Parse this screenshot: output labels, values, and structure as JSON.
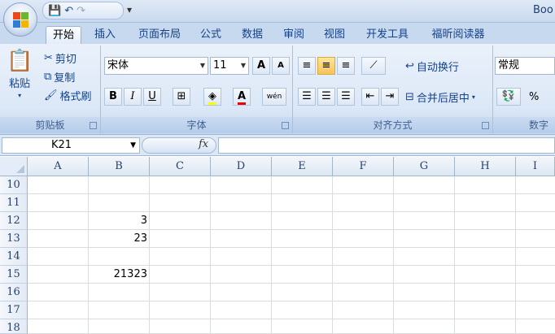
{
  "title": "Boo",
  "quick_access": {
    "save_icon": "save-icon",
    "undo_icon": "undo-icon",
    "redo_icon": "redo-icon",
    "more": "▾"
  },
  "tabs": [
    {
      "label": "开始",
      "active": true
    },
    {
      "label": "插入"
    },
    {
      "label": "页面布局"
    },
    {
      "label": "公式"
    },
    {
      "label": "数据"
    },
    {
      "label": "审阅"
    },
    {
      "label": "视图"
    },
    {
      "label": "开发工具"
    },
    {
      "label": "福昕阅读器"
    }
  ],
  "clipboard": {
    "group_label": "剪贴板",
    "paste": "粘贴",
    "cut": "剪切",
    "copy": "复制",
    "format_painter": "格式刷"
  },
  "font": {
    "group_label": "字体",
    "font_name": "宋体",
    "font_size": "11",
    "bold": "B",
    "italic": "I",
    "underline": "U",
    "grow": "A",
    "shrink": "A",
    "wen": "wén"
  },
  "alignment": {
    "group_label": "对齐方式",
    "wrap_text": "自动换行",
    "merge_center": "合并后居中"
  },
  "number": {
    "group_label": "数字",
    "format": "常规",
    "percent": "%"
  },
  "formula_bar": {
    "name_box": "K21",
    "fx": "fx",
    "formula": ""
  },
  "columns": [
    "A",
    "B",
    "C",
    "D",
    "E",
    "F",
    "G",
    "H",
    "I"
  ],
  "rows": [
    {
      "num": "10",
      "B": ""
    },
    {
      "num": "11",
      "B": ""
    },
    {
      "num": "12",
      "B": "3"
    },
    {
      "num": "13",
      "B": "23"
    },
    {
      "num": "14",
      "B": ""
    },
    {
      "num": "15",
      "B": "21323"
    },
    {
      "num": "16",
      "B": ""
    },
    {
      "num": "17",
      "B": ""
    },
    {
      "num": "18",
      "B": ""
    }
  ],
  "colors": {
    "accent": "#15428b",
    "ribbon_bg": "#dce8f7",
    "selected": "#f7c15a"
  }
}
